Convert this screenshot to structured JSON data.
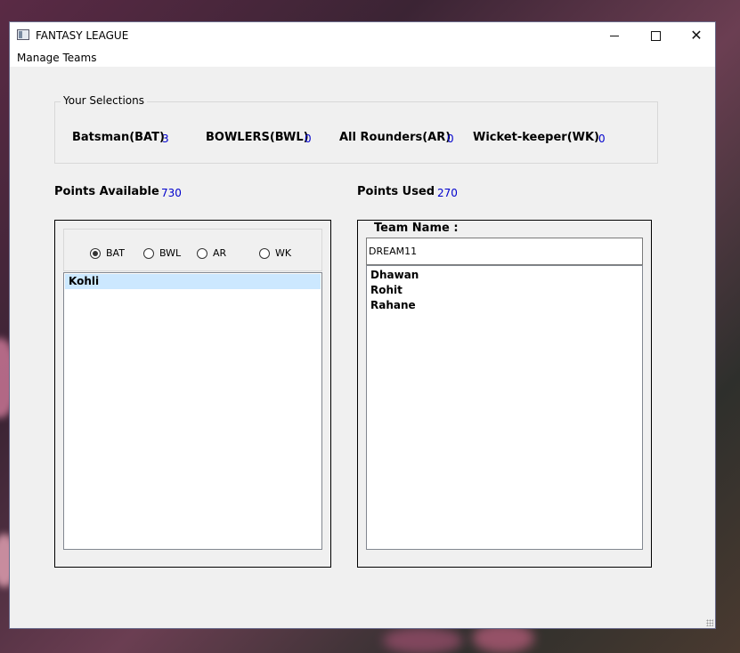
{
  "window": {
    "title": "FANTASY LEAGUE",
    "icon": "app-window-icon",
    "controls": {
      "minimize_icon": "minimize-icon",
      "maximize_icon": "maximize-icon",
      "close_icon": "close-icon",
      "close_glyph": "✕"
    }
  },
  "menu": {
    "items": [
      "Manage Teams"
    ]
  },
  "selections": {
    "title": "Your Selections",
    "batsman_label": "Batsman(BAT)",
    "batsman_count": "3",
    "bowlers_label": "BOWLERS(BWL)",
    "bowlers_count": "0",
    "allrounders_label": "All Rounders(AR)",
    "allrounders_count": "0",
    "wk_label": "Wicket-keeper(WK)",
    "wk_count": "0"
  },
  "points": {
    "available_label": "Points Available",
    "available_value": "730",
    "used_label": "Points Used",
    "used_value": "270"
  },
  "player_panel": {
    "radios": [
      {
        "label": "BAT",
        "checked": true
      },
      {
        "label": "BWL",
        "checked": false
      },
      {
        "label": "AR",
        "checked": false
      },
      {
        "label": "WK",
        "checked": false
      }
    ],
    "players": [
      "Kohli"
    ],
    "selected_player": "Kohli"
  },
  "team_panel": {
    "title": "Team Name :",
    "team_name": "DREAM11",
    "members": [
      "Dhawan",
      "Rohit",
      "Rahane"
    ]
  },
  "colors": {
    "value_text": "#0000cc",
    "selection_highlight": "#cce8ff",
    "window_bg": "#f0f0f0"
  }
}
